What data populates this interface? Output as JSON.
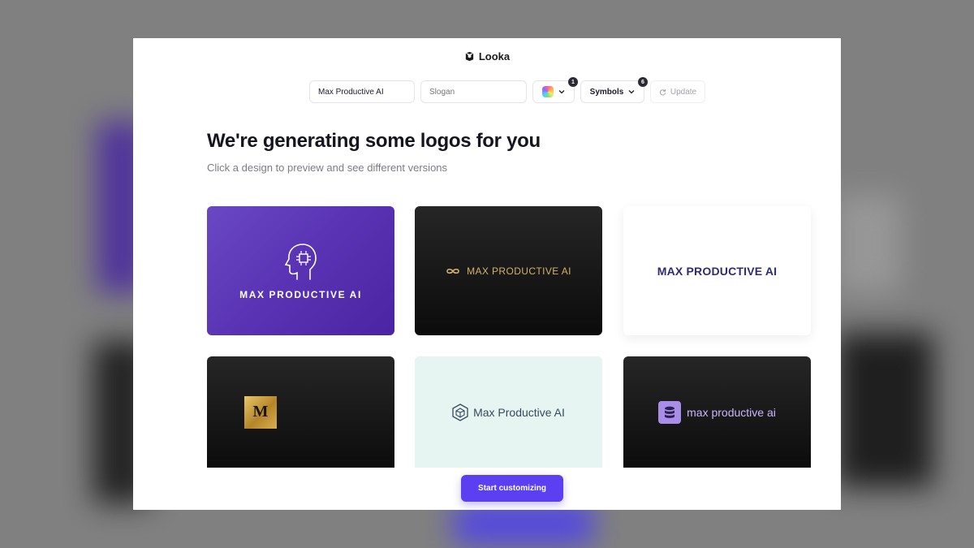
{
  "app": {
    "name": "Looka"
  },
  "toolbar": {
    "company_name_value": "Max Productive AI",
    "slogan_placeholder": "Slogan",
    "color_badge": "1",
    "symbols_label": "Symbols",
    "symbols_badge": "6",
    "update_label": "Update"
  },
  "main": {
    "headline": "We're generating some logos for you",
    "subline": "Click a design to preview and see different versions"
  },
  "logos": [
    {
      "text": "MAX PRODUCTIVE AI",
      "icon": "head-circuit-icon",
      "background": "#5a34b4",
      "text_color": "#ffffff"
    },
    {
      "text": "MAX PRODUCTIVE AI",
      "icon": "infinity-icon",
      "background": "#111111",
      "text_color": "#d2b26a"
    },
    {
      "text": "MAX PRODUCTIVE AI",
      "background": "#ffffff",
      "text_color": "#2e2b75"
    },
    {
      "text": "M",
      "icon": "gold-monogram-box",
      "background": "#111111",
      "text_color": "#1a1404"
    },
    {
      "text": "Max Productive AI",
      "icon": "hexagon-cube-icon",
      "background": "#e7f5f2",
      "text_color": "#36495a"
    },
    {
      "text": "max productive ai",
      "icon": "database-icon",
      "background": "#111111",
      "text_color": "#c9b7ff"
    }
  ],
  "cta": {
    "label": "Start customizing"
  },
  "colors": {
    "accent": "#5b3ff1",
    "heading": "#15151f",
    "muted": "#7c7c88"
  }
}
